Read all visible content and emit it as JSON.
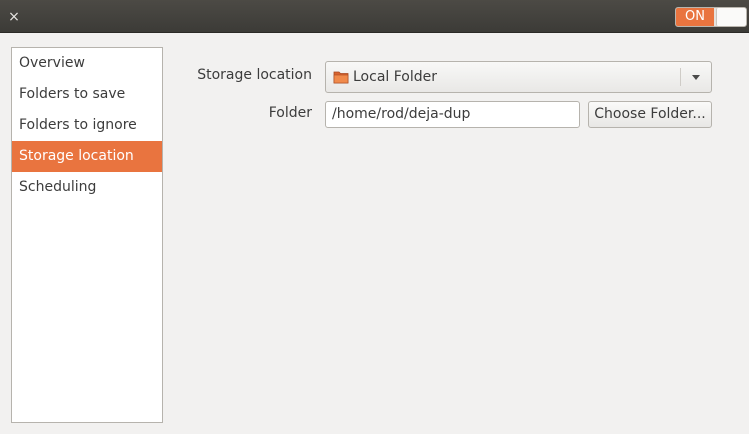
{
  "titlebar": {
    "close_glyph": "×",
    "switch_label": "ON",
    "accent_color": "#e9743f"
  },
  "sidebar": {
    "items": [
      {
        "label": "Overview"
      },
      {
        "label": "Folders to save"
      },
      {
        "label": "Folders to ignore"
      },
      {
        "label": "Storage location",
        "selected": true
      },
      {
        "label": "Scheduling"
      }
    ]
  },
  "main": {
    "storage_label": "Storage location",
    "storage_value": "Local Folder",
    "storage_icon": "folder-icon",
    "folder_label": "Folder",
    "folder_value": "/home/rod/deja-dup",
    "choose_button": "Choose Folder..."
  }
}
